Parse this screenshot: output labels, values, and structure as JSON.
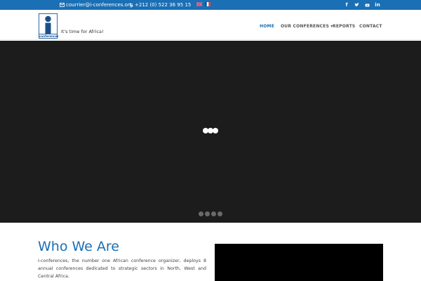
{
  "topbar": {
    "email": "courrier@i-conferences.org",
    "phone": "+212 (0) 522 36 95 15",
    "languages": [
      "English",
      "Français"
    ],
    "social": [
      "facebook-icon",
      "twitter-icon",
      "youtube-icon",
      "linkedin-icon"
    ],
    "background_color": "#1a6fb5"
  },
  "header": {
    "logo_text": "conferences",
    "tagline": "It's time for Africa!",
    "nav": [
      {
        "label": "HOME",
        "active": true
      },
      {
        "label": "OUR CONFERENCES ▾",
        "active": false
      },
      {
        "label": "REPORTS",
        "active": false
      },
      {
        "label": "CONTACT",
        "active": false
      }
    ],
    "accent_color": "#1a6fb5"
  },
  "hero": {
    "background_color": "#1c1c1c",
    "slide_count": 4
  },
  "about": {
    "title": "Who We Are",
    "text": "I-conferences, the number one African conference organizer, deploys 8 annual conferences dedicated to strategic sectors in North, West and Central Africa."
  }
}
